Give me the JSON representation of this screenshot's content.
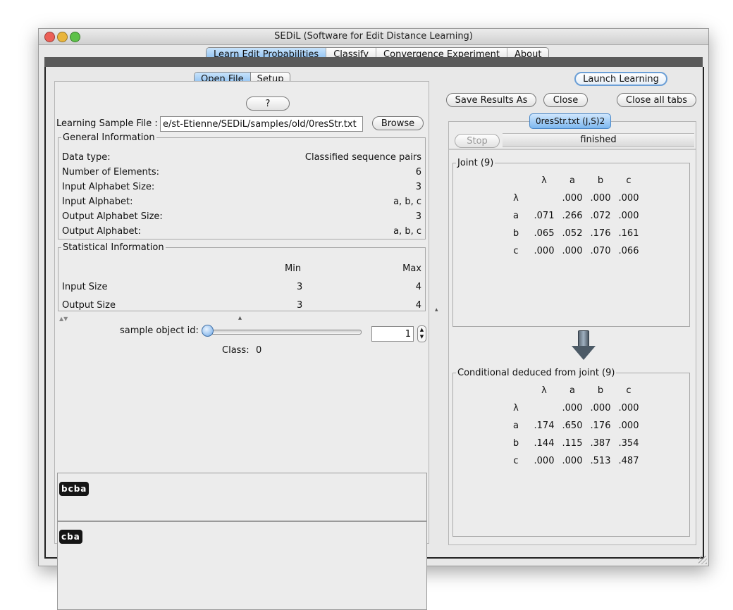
{
  "window": {
    "title": "SEDiL (Software for Edit Distance Learning)"
  },
  "top_tabs": [
    "Learn Edit Probabilities",
    "Classify",
    "Convergence Experiment",
    "About"
  ],
  "left": {
    "subtabs": [
      "Open File",
      "Setup"
    ],
    "help_label": "?",
    "file_label": "Learning Sample File :",
    "file_value": "e/st-Etienne/SEDiL/samples/old/0resStr.txt",
    "browse_label": "Browse",
    "general": {
      "legend": "General Information",
      "rows": [
        {
          "label": "Data type:",
          "value": "Classified sequence pairs"
        },
        {
          "label": "Number of Elements:",
          "value": "6"
        },
        {
          "label": "Input Alphabet Size:",
          "value": "3"
        },
        {
          "label": "Input Alphabet:",
          "value": "a, b, c"
        },
        {
          "label": "Output Alphabet Size:",
          "value": "3"
        },
        {
          "label": "Output Alphabet:",
          "value": "a, b, c"
        }
      ]
    },
    "statistical": {
      "legend": "Statistical Information",
      "min_header": "Min",
      "max_header": "Max",
      "rows": [
        {
          "label": "Input Size",
          "min": "3",
          "max": "4"
        },
        {
          "label": "Output Size",
          "min": "3",
          "max": "4"
        }
      ]
    },
    "sample": {
      "label": "sample object id:",
      "slider_level": 0,
      "value": "1",
      "class_label": "Class:",
      "class_value": "0"
    },
    "pair": {
      "input": "bcba",
      "output": "cba"
    }
  },
  "right": {
    "launch_label": "Launch Learning",
    "save_label": "Save Results As",
    "close_label": "Close",
    "close_all_label": "Close all tabs",
    "result_tab": "0resStr.txt (J,S)2",
    "stop_label": "Stop",
    "status": "finished",
    "joint": {
      "legend": "Joint (9)",
      "headers": [
        "λ",
        "a",
        "b",
        "c"
      ],
      "rows": [
        {
          "label": "λ",
          "cells": [
            "",
            ".000",
            ".000",
            ".000"
          ]
        },
        {
          "label": "a",
          "cells": [
            ".071",
            ".266",
            ".072",
            ".000"
          ]
        },
        {
          "label": "b",
          "cells": [
            ".065",
            ".052",
            ".176",
            ".161"
          ]
        },
        {
          "label": "c",
          "cells": [
            ".000",
            ".000",
            ".070",
            ".066"
          ]
        }
      ]
    },
    "conditional": {
      "legend": "Conditional deduced from joint (9)",
      "headers": [
        "λ",
        "a",
        "b",
        "c"
      ],
      "rows": [
        {
          "label": "λ",
          "cells": [
            "",
            ".000",
            ".000",
            ".000"
          ]
        },
        {
          "label": "a",
          "cells": [
            ".174",
            ".650",
            ".176",
            ".000"
          ]
        },
        {
          "label": "b",
          "cells": [
            ".144",
            ".115",
            ".387",
            ".354"
          ]
        },
        {
          "label": "c",
          "cells": [
            ".000",
            ".000",
            ".513",
            ".487"
          ]
        }
      ]
    }
  },
  "colors": {
    "accent": "#7db7ef",
    "traffic_red": "#ec5f56",
    "traffic_yellow": "#e9b53b",
    "traffic_green": "#5dc149"
  }
}
